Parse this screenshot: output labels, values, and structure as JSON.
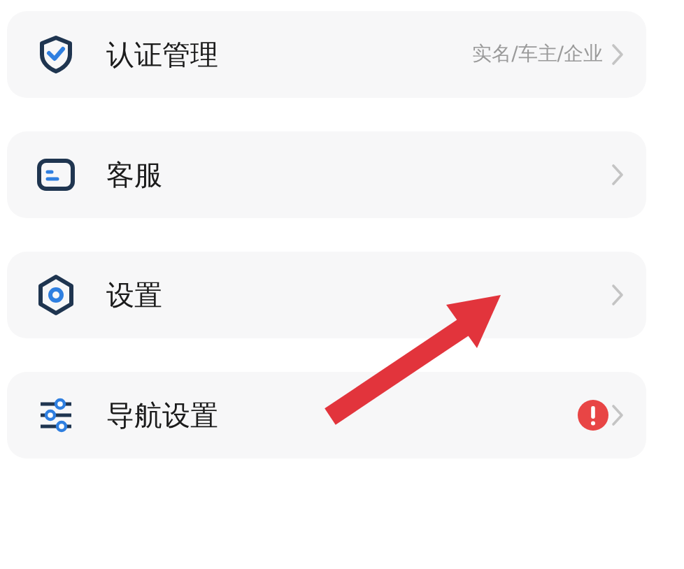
{
  "items": [
    {
      "label": "认证管理",
      "detail": "实名/车主/企业",
      "alert": false
    },
    {
      "label": "客服",
      "alert": false
    },
    {
      "label": "设置",
      "alert": false
    },
    {
      "label": "导航设置",
      "alert": true
    }
  ],
  "annotation": {
    "kind": "arrow"
  }
}
